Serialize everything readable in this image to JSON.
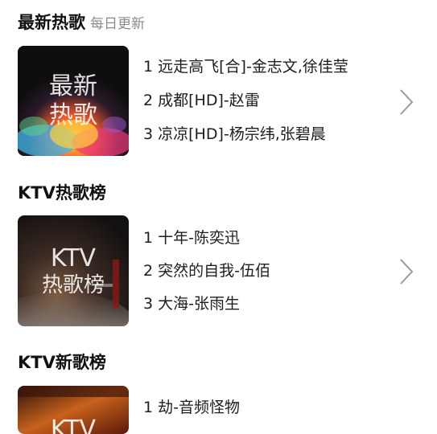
{
  "sections": [
    {
      "title": "最新热歌",
      "subtitle": "每日更新",
      "cover_lines": [
        "最新",
        "热歌"
      ],
      "songs": [
        "1 远走高飞[合]-金志文,徐佳莹",
        "2 成都[HD]-赵雷",
        "3 凉凉[HD]-杨宗纬,张碧晨"
      ]
    },
    {
      "title": "KTV热歌榜",
      "cover_lines": [
        "KTV",
        "热歌榜"
      ],
      "songs": [
        "1 十年-陈奕迅",
        "2 突然的自我-伍佰",
        "3 大海-张雨生"
      ]
    },
    {
      "title": "KTV新歌榜",
      "cover_lines": [
        "KTV"
      ],
      "songs": [
        "1 劫-音频怪物"
      ]
    }
  ],
  "icons": {
    "chevron": "chevron-right-icon"
  },
  "colors": {
    "text": "#1a1a1a",
    "subtitle": "#8a8a8a",
    "chevron": "#9a9a9a"
  }
}
